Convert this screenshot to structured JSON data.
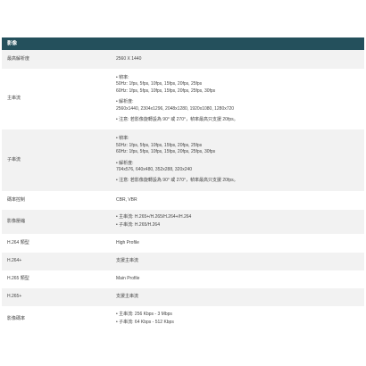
{
  "section_title": "影像",
  "colors": {
    "header_bg": "#24505c",
    "header_text": "#ffffff",
    "row_alt_bg": "#f2f2f2",
    "text": "#444444"
  },
  "rows": [
    {
      "label": "最高解析度",
      "value": [
        [
          "2560 X 1440"
        ]
      ]
    },
    {
      "label": "主串流",
      "value": [
        [
          "• 幀率:",
          "50Hz: 1fps, 5fps, 10fps, 15fps, 20fps, 25fps",
          "60Hz: 1fps, 5fps, 10fps, 15fps, 20fps, 25fps, 30fps"
        ],
        [
          "• 解析度:",
          "2560x1440, 2304x1296, 2048x1280, 1920x1080, 1280x720"
        ],
        [
          "• 注意: 若影像旋轉設為 90° 或 270°，幀率最高只支援 20fps。"
        ]
      ]
    },
    {
      "label": "子串流",
      "value": [
        [
          "• 幀率:",
          "50Hz: 1fps, 5fps, 10fps, 15fps, 20fps, 25fps",
          "60Hz: 1fps, 5fps, 10fps, 15fps, 20fps, 25fps, 30fps"
        ],
        [
          "• 解析度:",
          "704x576, 640x480, 352x288, 320x240"
        ],
        [
          "• 注意: 若影像旋轉設為 90° 或 270°，幀率最高只支援 20fps。"
        ]
      ]
    },
    {
      "label": "碼率控制",
      "value": [
        [
          "CBR, VBR"
        ]
      ]
    },
    {
      "label": "影像壓縮",
      "value": [
        [
          "• 主串流: H.265+/H.265/H.264+/H.264"
        ],
        [
          "• 子串流: H.265/H.264"
        ]
      ]
    },
    {
      "label": "H.264 類型",
      "value": [
        [
          "High Profile"
        ]
      ]
    },
    {
      "label": "H.264+",
      "value": [
        [
          "支援主串流"
        ]
      ]
    },
    {
      "label": "H.265 類型",
      "value": [
        [
          "Main Profile"
        ]
      ]
    },
    {
      "label": "H.265+",
      "value": [
        [
          "支援主串流"
        ]
      ]
    },
    {
      "label": "影像碼率",
      "value": [
        [
          "• 主串流: 256 Kbps - 3 Mbps"
        ],
        [
          "• 子串流: 64 Kbps - 512 Kbps"
        ]
      ]
    }
  ]
}
